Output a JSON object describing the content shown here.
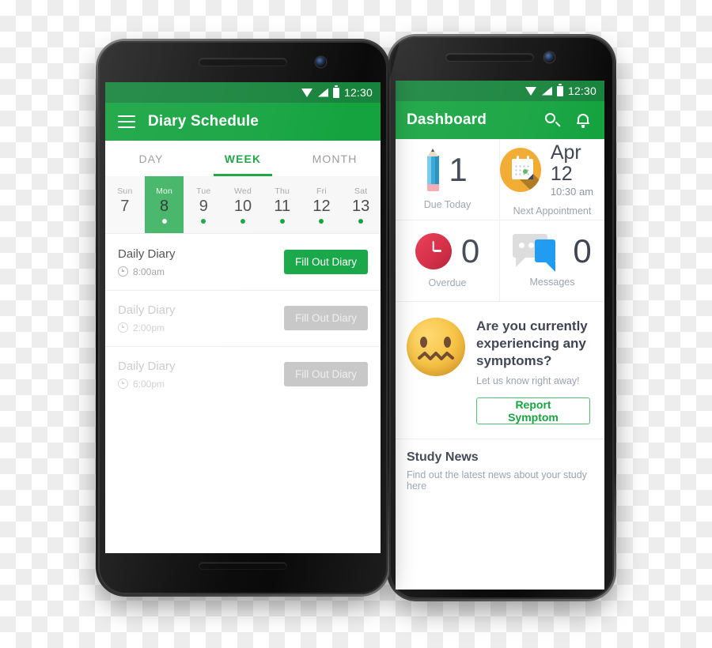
{
  "theme": {
    "green": "#14a33f",
    "green_dark": "#17833c",
    "green_btn": "#1aa84a",
    "green_sel": "#3fb463",
    "disabled_gray": "#c8c8c8",
    "text_dark": "#3d4452",
    "text_muted": "#9aa2b0",
    "orange": "#f0a92c",
    "red": "#d4243f",
    "blue": "#1e9bf0"
  },
  "phone_left": {
    "status_bar": {
      "time": "12:30",
      "wifi_icon": "wifi-icon",
      "signal_icon": "signal-icon",
      "battery_icon": "battery-icon"
    },
    "app_bar": {
      "menu_icon": "hamburger-menu-icon",
      "title": "Diary Schedule"
    },
    "tabs": [
      {
        "label": "DAY",
        "active": false
      },
      {
        "label": "WEEK",
        "active": true
      },
      {
        "label": "MONTH",
        "active": false
      }
    ],
    "week_strip": [
      {
        "name": "Sun",
        "num": "7",
        "selected": false,
        "dot": false
      },
      {
        "name": "Mon",
        "num": "8",
        "selected": true,
        "dot": true
      },
      {
        "name": "Tue",
        "num": "9",
        "selected": false,
        "dot": true
      },
      {
        "name": "Wed",
        "num": "10",
        "selected": false,
        "dot": true
      },
      {
        "name": "Thu",
        "num": "11",
        "selected": false,
        "dot": true
      },
      {
        "name": "Fri",
        "num": "12",
        "selected": false,
        "dot": true
      },
      {
        "name": "Sat",
        "num": "13",
        "selected": false,
        "dot": true
      }
    ],
    "diary_rows": [
      {
        "title": "Daily Diary",
        "time": "8:00am",
        "button": "Fill Out Diary",
        "enabled": true,
        "clock_icon": "clock-icon"
      },
      {
        "title": "Daily Diary",
        "time": "2:00pm",
        "button": "Fill Out Diary",
        "enabled": false,
        "clock_icon": "clock-icon"
      },
      {
        "title": "Daily Diary",
        "time": "6:00pm",
        "button": "Fill Out Diary",
        "enabled": false,
        "clock_icon": "clock-icon"
      }
    ]
  },
  "phone_right": {
    "status_bar": {
      "time": "12:30",
      "wifi_icon": "wifi-icon",
      "signal_icon": "signal-icon",
      "battery_icon": "battery-icon"
    },
    "app_bar": {
      "title": "Dashboard",
      "search_icon": "search-icon",
      "bell_icon": "notification-bell-icon"
    },
    "cards": [
      {
        "icon": "pencil-icon",
        "value": "1",
        "sub": "",
        "label": "Due Today"
      },
      {
        "icon": "calendar-icon",
        "value": "Apr 12",
        "sub": "10:30 am",
        "label": "Next Appointment"
      },
      {
        "icon": "alarm-icon",
        "value": "0",
        "sub": "",
        "label": "Overdue"
      },
      {
        "icon": "chat-icon",
        "value": "0",
        "sub": "",
        "label": "Messages"
      }
    ],
    "symptom": {
      "emoji_icon": "confounded-face-icon",
      "question": "Are you currently experiencing any symptoms?",
      "subtitle": "Let us know right away!",
      "button": "Report Symptom"
    },
    "study_news": {
      "title": "Study News",
      "subtitle": "Find out the latest news about your study here"
    }
  }
}
